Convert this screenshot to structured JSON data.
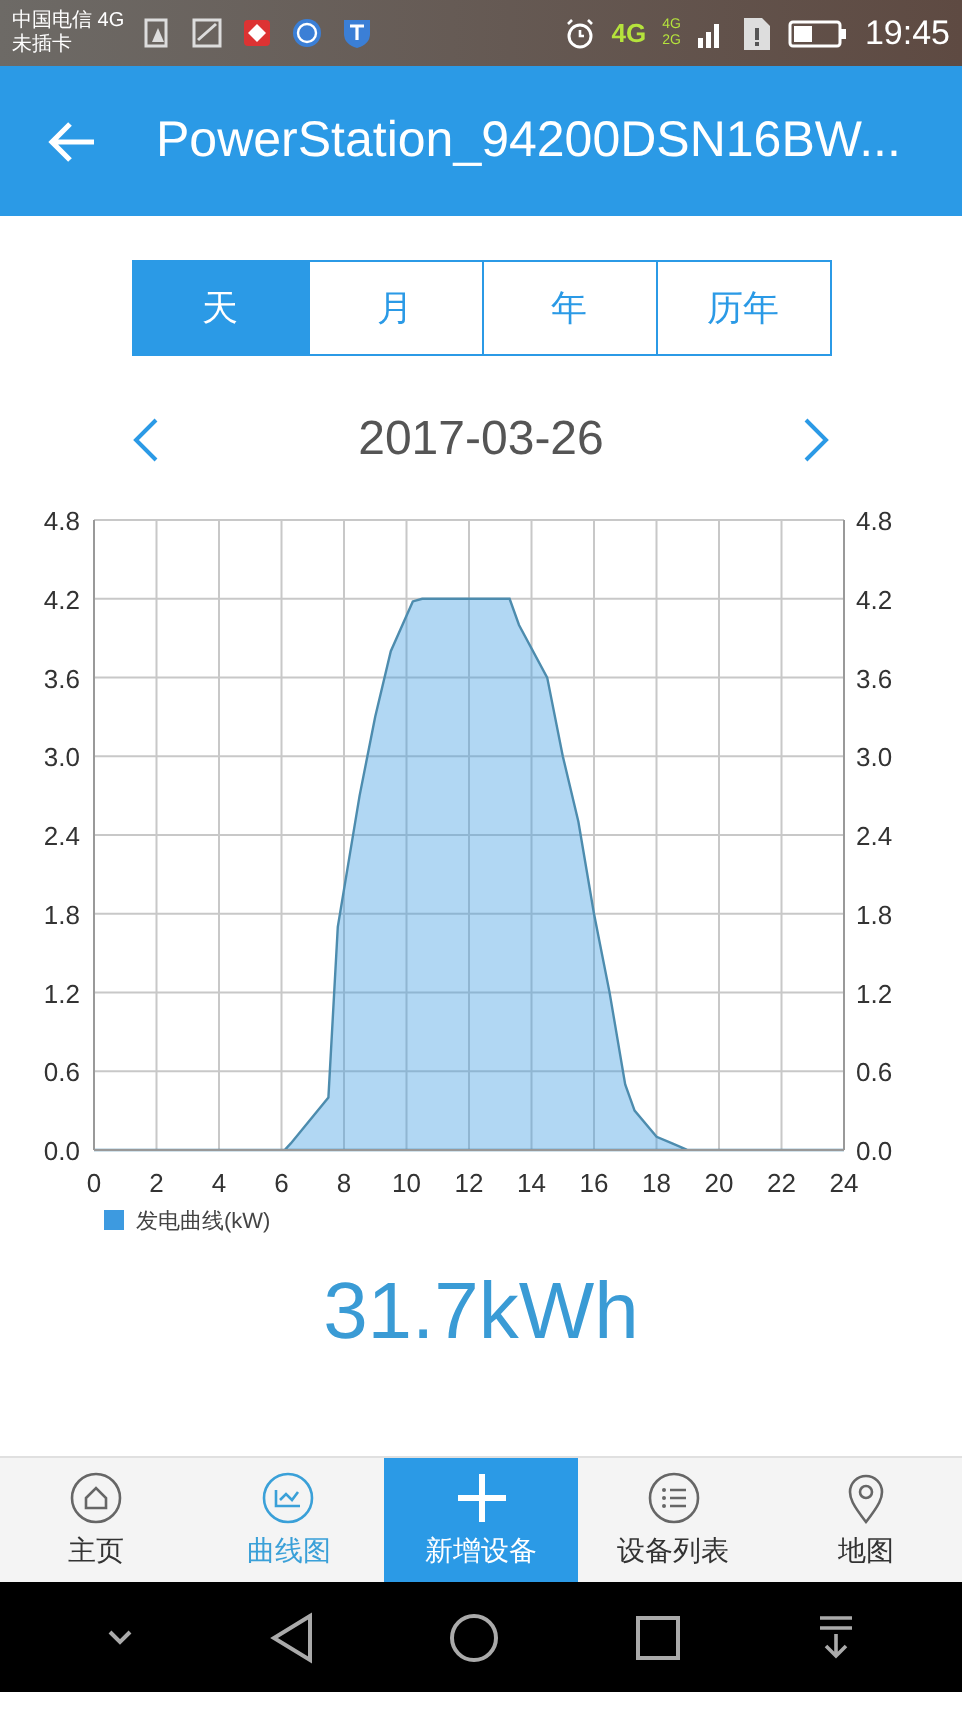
{
  "status_bar": {
    "carrier": "中国电信 4G",
    "sim": "未插卡",
    "network": "4G",
    "signal_top": "4G",
    "signal_bottom": "2G",
    "time": "19:45"
  },
  "app_bar": {
    "title": "PowerStation_94200DSN16BW..."
  },
  "tabs": [
    {
      "label": "天",
      "selected": true
    },
    {
      "label": "月",
      "selected": false
    },
    {
      "label": "年",
      "selected": false
    },
    {
      "label": "历年",
      "selected": false
    }
  ],
  "date": "2017-03-26",
  "chart": {
    "chart_data": {
      "type": "area",
      "x": [
        0,
        6.1,
        6.3,
        7.5,
        7.8,
        8.5,
        9,
        9.5,
        10.2,
        10.5,
        13.3,
        13.6,
        14.5,
        15,
        15.5,
        16,
        16.5,
        17,
        17.3,
        18,
        18.5,
        19,
        24
      ],
      "series": [
        {
          "name": "发电曲线(kW)",
          "color": "#3d9ae0",
          "values": [
            0,
            0,
            0.05,
            0.4,
            1.7,
            2.7,
            3.3,
            3.8,
            4.18,
            4.2,
            4.2,
            4.0,
            3.6,
            3.0,
            2.5,
            1.8,
            1.2,
            0.5,
            0.3,
            0.1,
            0.05,
            0,
            0
          ]
        }
      ],
      "xlim": [
        0,
        24
      ],
      "ylim": [
        0,
        4.8
      ],
      "xticks": [
        0,
        2,
        4,
        6,
        8,
        10,
        12,
        14,
        16,
        18,
        20,
        22,
        24
      ],
      "yticks": [
        {
          "value": 0,
          "label": "0.0"
        },
        {
          "value": 0.6,
          "label": "0.6"
        },
        {
          "value": 1.2,
          "label": "1.2"
        },
        {
          "value": 1.8,
          "label": "1.8"
        },
        {
          "value": 2.4,
          "label": "2.4"
        },
        {
          "value": 3.0,
          "label": "3.0"
        },
        {
          "value": 3.6,
          "label": "3.6"
        },
        {
          "value": 4.2,
          "label": "4.2"
        },
        {
          "value": 4.8,
          "label": "4.8"
        }
      ],
      "grid": true
    },
    "right_axis_labels": [
      "4.8",
      "4.2",
      "3.6",
      "3.0",
      "2.4",
      "1.8",
      "1.2",
      "0.6",
      "0.0"
    ]
  },
  "total": "31.7kWh",
  "bottom_nav": [
    {
      "label": "主页",
      "kind": "tab",
      "selected": false
    },
    {
      "label": "曲线图",
      "kind": "tab",
      "selected": true
    },
    {
      "label": "新增设备",
      "kind": "add"
    },
    {
      "label": "设备列表",
      "kind": "tab",
      "selected": false
    },
    {
      "label": "地图",
      "kind": "tab",
      "selected": false
    }
  ]
}
